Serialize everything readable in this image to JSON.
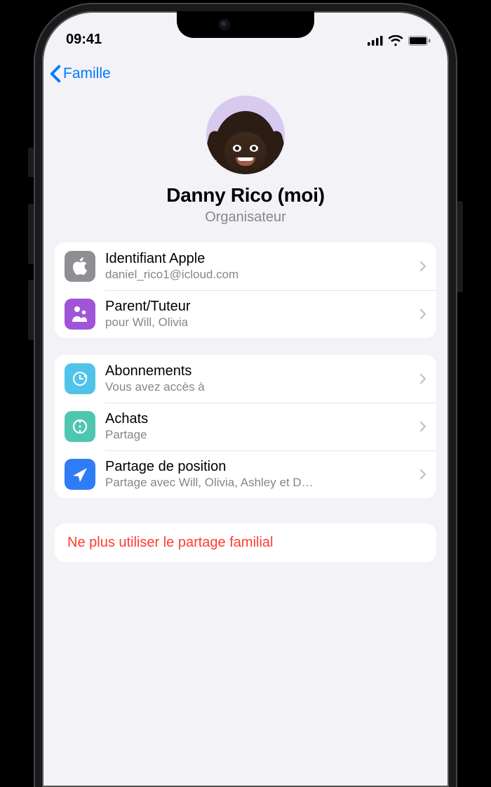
{
  "status": {
    "time": "09:41"
  },
  "nav": {
    "back": "Famille"
  },
  "profile": {
    "name": "Danny Rico (moi)",
    "role": "Organisateur"
  },
  "group1": {
    "apple_id": {
      "title": "Identifiant Apple",
      "sub": "daniel_rico1@icloud.com"
    },
    "parent": {
      "title": "Parent/Tuteur",
      "sub": "pour Will, Olivia"
    }
  },
  "group2": {
    "subs": {
      "title": "Abonnements",
      "sub": "Vous avez accès à"
    },
    "purch": {
      "title": "Achats",
      "sub": "Partage"
    },
    "loc": {
      "title": "Partage de position",
      "sub": "Partage avec Will, Olivia, Ashley et D…"
    }
  },
  "danger": {
    "leave": "Ne plus utiliser le partage familial"
  }
}
